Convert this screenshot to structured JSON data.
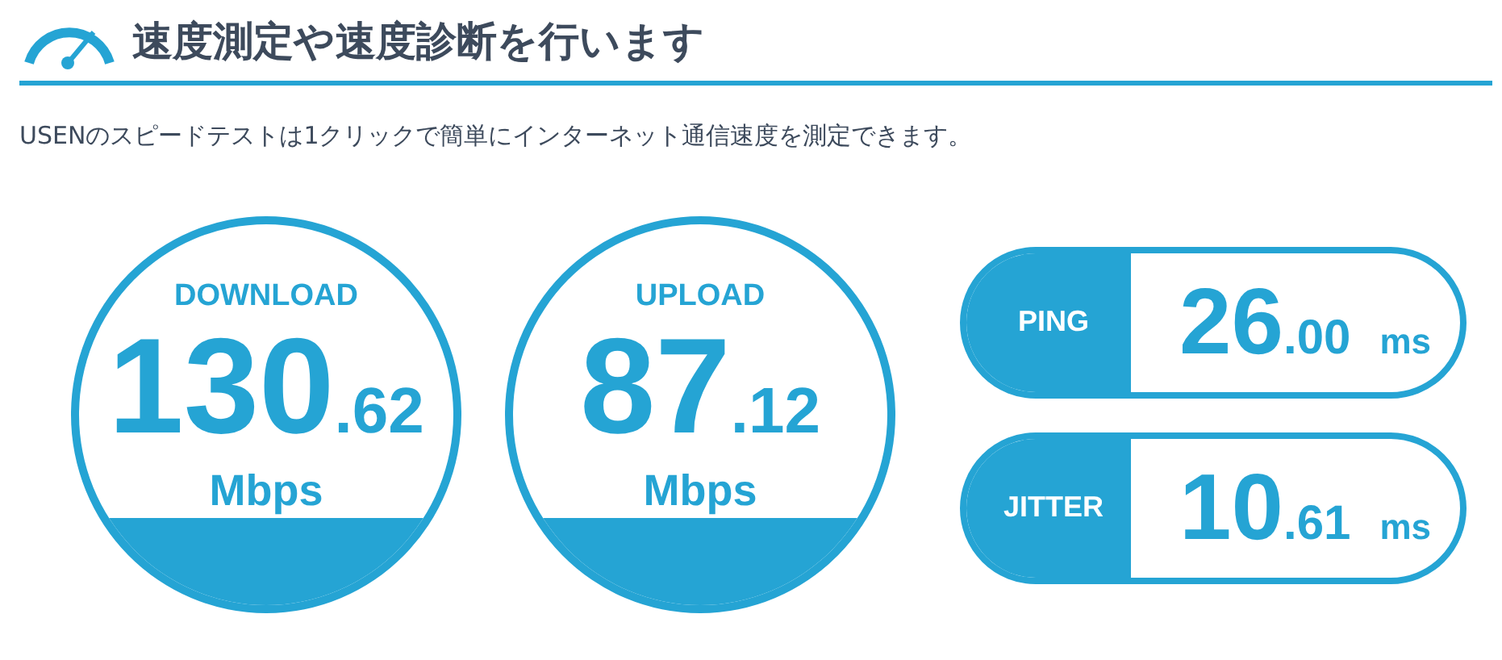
{
  "header": {
    "title": "速度測定や速度診断を行います"
  },
  "description": "USENのスピードテストは1クリックで簡単にインターネット通信速度を測定できます。",
  "gauges": [
    {
      "label": "DOWNLOAD",
      "integer": "130",
      "decimal": ".62",
      "unit": "Mbps"
    },
    {
      "label": "UPLOAD",
      "integer": "87",
      "decimal": ".12",
      "unit": "Mbps"
    }
  ],
  "metrics": [
    {
      "label": "PING",
      "integer": "26",
      "decimal": ".00",
      "unit": "ms"
    },
    {
      "label": "JITTER",
      "integer": "10",
      "decimal": ".61",
      "unit": "ms"
    }
  ]
}
